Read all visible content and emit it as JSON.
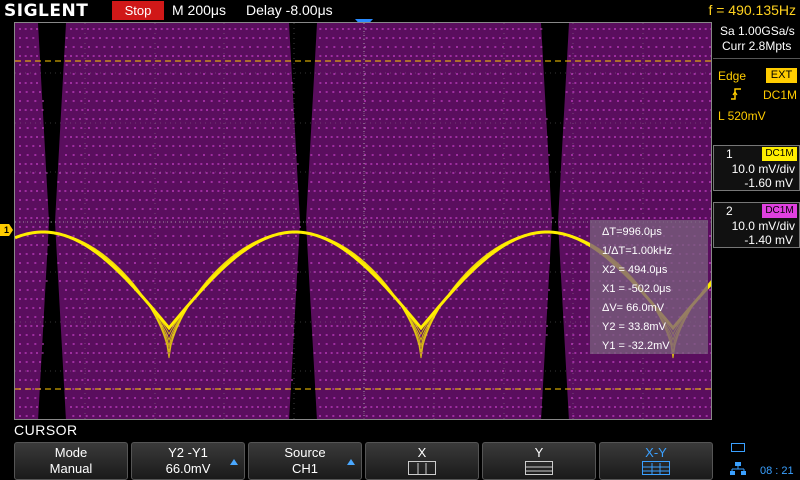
{
  "header": {
    "brand": "SIGLENT",
    "run_status": "Stop",
    "timebase": "M 200μs",
    "delay": "Delay -8.00μs",
    "frequency": "f = 490.135Hz"
  },
  "acquisition": {
    "sample_rate": "Sa 1.00GSa/s",
    "memory_depth": "Curr 2.8Mpts"
  },
  "trigger": {
    "mode": "Edge",
    "source": "EXT",
    "coupling": "DC1M",
    "level": "L  520mV",
    "slope_icon": "rising-edge-icon"
  },
  "channels": [
    {
      "number": "1",
      "coupling": "DC1M",
      "scale": "10.0 mV/div",
      "offset": "-1.60 mV",
      "color": "#ffee00"
    },
    {
      "number": "2",
      "coupling": "DC1M",
      "scale": "10.0 mV/div",
      "offset": "-1.40 mV",
      "color": "#e040e0"
    }
  ],
  "cursor_readout": {
    "delta_t": "ΔT=996.0μs",
    "one_over_delta_t": "1/ΔT=1.00kHz",
    "x2": "X2 = 494.0μs",
    "x1": "X1 = -502.0μs",
    "delta_v": "ΔV= 66.0mV",
    "y2": "Y2 = 33.8mV",
    "y1": "Y1 = -32.2mV"
  },
  "menu": {
    "title": "CURSOR",
    "softkeys": [
      {
        "label": "Mode",
        "value": "Manual"
      },
      {
        "label": "Y2 -Y1",
        "value": "66.0mV"
      },
      {
        "label": "Source",
        "value": "CH1"
      },
      {
        "label": "X",
        "value": ""
      },
      {
        "label": "Y",
        "value": ""
      },
      {
        "label": "X-Y",
        "value": ""
      }
    ]
  },
  "status": {
    "clock": "08 : 21",
    "battery_icon": "battery-icon",
    "network_icon": "network-icon"
  },
  "colors": {
    "ch1": "#ffee00",
    "ch2": "#e040e0",
    "accent": "#3aa0ff",
    "stop": "#d01818",
    "trigger": "#ffcc00"
  }
}
